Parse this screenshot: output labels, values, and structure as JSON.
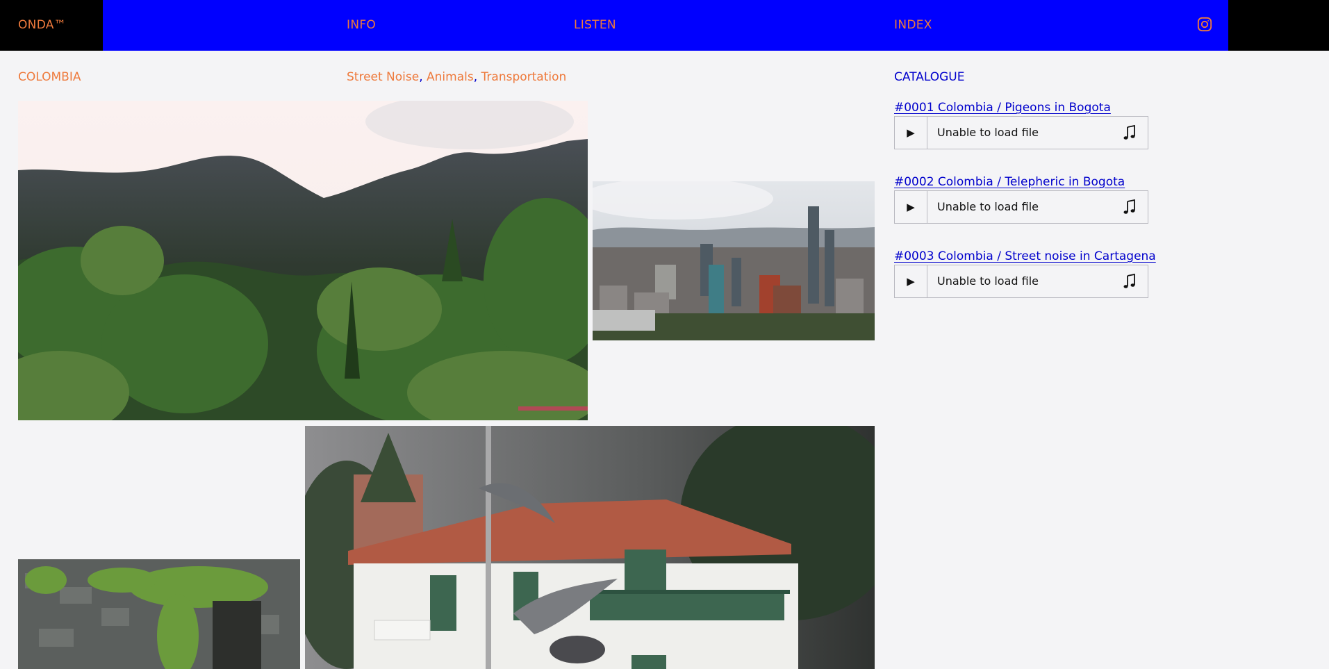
{
  "nav": {
    "brand": "ONDA™",
    "info": "INFO",
    "listen": "LISTEN",
    "index": "INDEX",
    "instagram_icon": "instagram-icon"
  },
  "page": {
    "country": "COLOMBIA",
    "tags": [
      "Street Noise",
      "Animals",
      "Transportation"
    ],
    "tag_separator": ","
  },
  "catalogue": {
    "title": "CATALOGUE",
    "tracks": [
      {
        "title": "#0001 Colombia  / Pigeons in Bogota",
        "status": "Unable to load file"
      },
      {
        "title": "#0002 Colombia / Telepheric in Bogota",
        "status": "Unable to load file"
      },
      {
        "title": "#0003 Colombia / Street noise in Cartagena",
        "status": "Unable to load file"
      }
    ]
  },
  "colors": {
    "nav_blue": "#0000ff",
    "accent_orange": "#ee7a3c",
    "link_blue": "#0000cc",
    "background": "#f4f4f6"
  }
}
